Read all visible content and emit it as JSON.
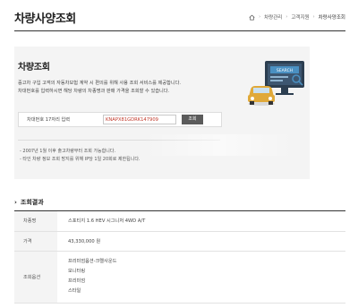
{
  "page": {
    "title": "차량사양조회"
  },
  "breadcrumb": {
    "home_icon": "home-icon",
    "items": [
      "차량관리",
      "고객지원",
      "차량사양조회"
    ],
    "separator": "›"
  },
  "search": {
    "title": "차량조회",
    "description": [
      "중고차 구입 고객의 자동차보험 계약 시 편의를 위해 사용 조회 서비스를 제공합니다.",
      "차대번호를 입력하시면 해당 차량의 차종명과 판매 가격을 조회할 수 있습니다."
    ],
    "input_label": "차대번호 17자리 입력",
    "vin_value": "KNAPX81GDRK147909",
    "button_label": "조회",
    "notes": [
      "- 2007년 1월 이후 출고차량부터 조회 가능합니다.",
      "- 타인 차량 정보 조회 방지를 위해 IP당 1일 20회로 제한됩니다."
    ],
    "illustration": {
      "label": "SEARCH",
      "icons": [
        "car-icon",
        "monitor-icon",
        "magnifier-icon"
      ],
      "colors": {
        "car": "#e0a93a",
        "screen": "#2c3e50",
        "accent": "#4a90c2"
      }
    }
  },
  "results": {
    "heading": "조회결과",
    "rows": [
      {
        "label": "차종명",
        "value": "스포티지 1.6 HEV 시그니처 4WD A/T"
      },
      {
        "label": "가격",
        "value": "43,330,000 원"
      },
      {
        "label": "조회옵션",
        "values": [
          "프리미엄옵션-크렐사운드",
          "모니터링",
          "프리미엄",
          "스타일"
        ]
      }
    ]
  }
}
